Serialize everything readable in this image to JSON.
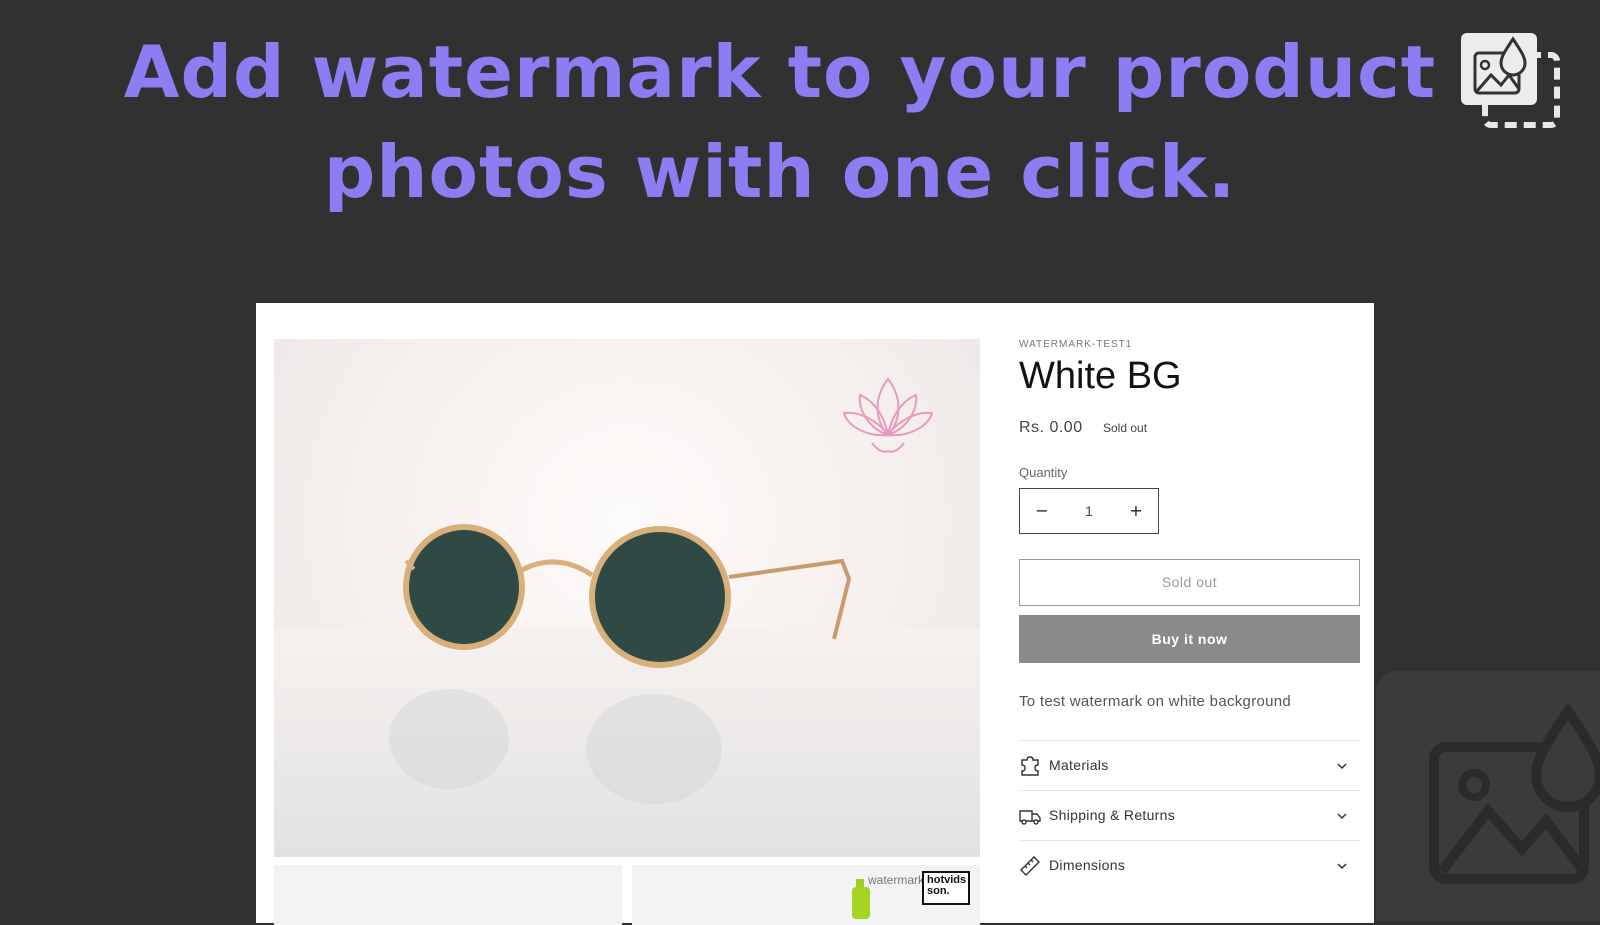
{
  "headline": {
    "line1": "Add watermark to your product",
    "line2": "photos with one click."
  },
  "colors": {
    "background": "#313131",
    "headline": "#8c7ef2",
    "card": "#ffffff",
    "buy_button": "#8a8a8a"
  },
  "product": {
    "vendor": "WATERMARK-TEST1",
    "title": "White BG",
    "price": "Rs. 0.00",
    "badge": "Sold out",
    "quantity_label": "Quantity",
    "quantity_value": "1",
    "minus_symbol": "−",
    "plus_symbol": "+",
    "soldout_button": "Sold out",
    "buy_button": "Buy it now",
    "description": "To test watermark on white background",
    "accordion": [
      {
        "label": "Materials",
        "icon": "puzzle-icon"
      },
      {
        "label": "Shipping & Returns",
        "icon": "truck-icon"
      },
      {
        "label": "Dimensions",
        "icon": "ruler-icon"
      }
    ]
  },
  "thumbnails": {
    "watermark_text": "watermark-text",
    "brand_box_text": "hotvids son."
  }
}
